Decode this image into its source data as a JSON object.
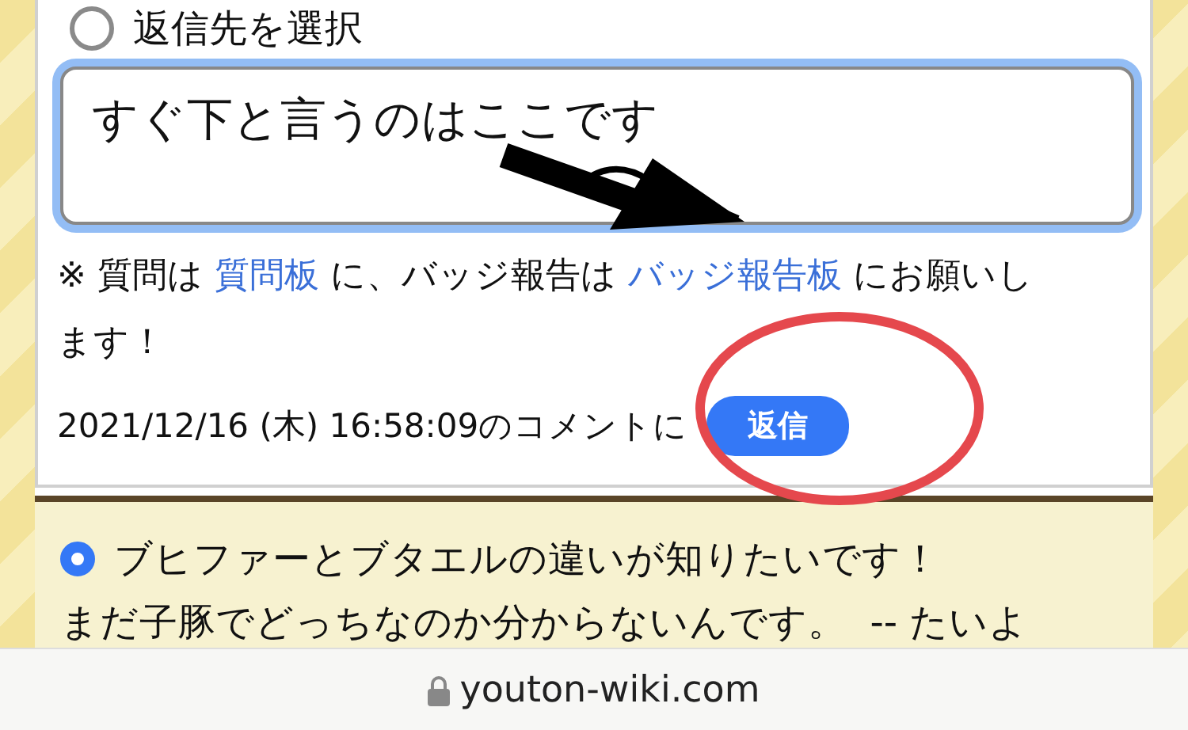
{
  "reply_target": {
    "label": "返信先を選択",
    "selected": false
  },
  "comment_field": {
    "value": "すぐ下と言うのはここです"
  },
  "note": [
    {
      "kind": "text",
      "text": "※ 質問は "
    },
    {
      "kind": "link",
      "text": "質問板"
    },
    {
      "kind": "text",
      "text": " に、バッジ報告は "
    },
    {
      "kind": "link",
      "text": "バッジ報告板"
    },
    {
      "kind": "text",
      "text": " にお願いします！"
    }
  ],
  "timestamp": "2021/12/16 (木) 16:58:09のコメントに",
  "reply_button": "返信",
  "topics": [
    {
      "selected": true,
      "title": "ブヒファーとブタエルの違いが知りたいです！",
      "body": "まだ子豚でどっちなのか分からないんです。  -- たいよ"
    }
  ],
  "address_bar": {
    "url": "youton-wiki.com",
    "secure": true
  }
}
